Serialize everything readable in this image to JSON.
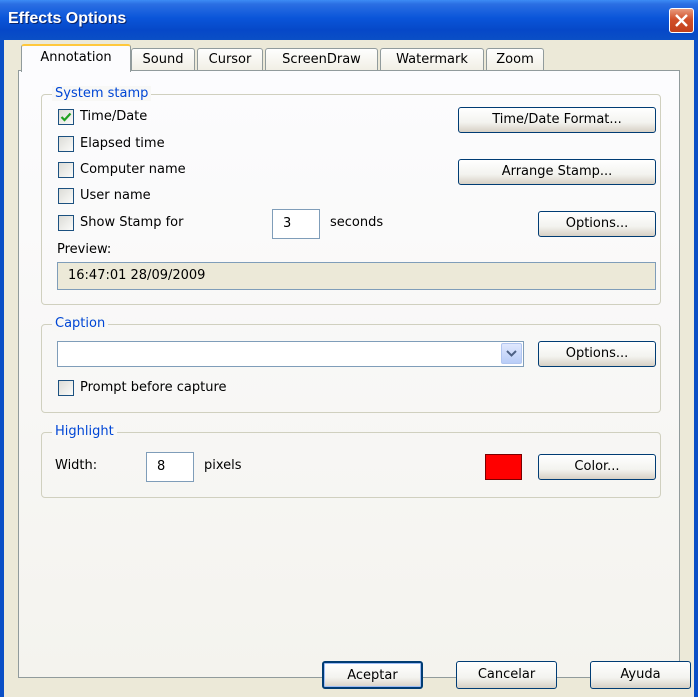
{
  "window": {
    "title": "Effects Options"
  },
  "tabs": [
    "Annotation",
    "Sound",
    "Cursor",
    "ScreenDraw",
    "Watermark",
    "Zoom"
  ],
  "active_tab": "Annotation",
  "system_stamp": {
    "legend": "System stamp",
    "time_date": {
      "label": "Time/Date",
      "checked": true
    },
    "elapsed_time": {
      "label": "Elapsed time",
      "checked": false
    },
    "computer_name": {
      "label": "Computer name",
      "checked": false
    },
    "user_name": {
      "label": "User name",
      "checked": false
    },
    "show_stamp": {
      "label": "Show Stamp for",
      "checked": false,
      "value": "3",
      "unit": "seconds"
    },
    "time_date_format_button": "Time/Date Format...",
    "arrange_stamp_button": "Arrange Stamp...",
    "options_button": "Options...",
    "preview_label": "Preview:",
    "preview_value": "16:47:01 28/09/2009"
  },
  "caption": {
    "legend": "Caption",
    "selected_value": "",
    "options_button": "Options...",
    "prompt_before_capture": {
      "label": "Prompt before capture",
      "checked": false
    }
  },
  "highlight": {
    "legend": "Highlight",
    "width_label": "Width:",
    "width_value": "8",
    "unit": "pixels",
    "color": "#ff0000",
    "color_button": "Color..."
  },
  "footer": {
    "ok": "Aceptar",
    "cancel": "Cancelar",
    "help": "Ayuda"
  }
}
